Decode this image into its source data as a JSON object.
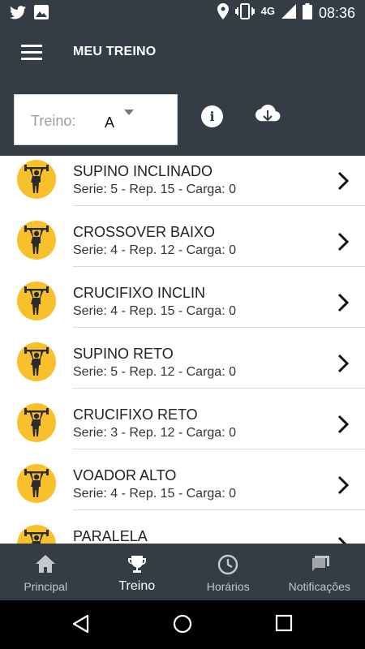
{
  "status_bar": {
    "time": "08:36",
    "network": "4G",
    "left_icons": [
      "twitter-icon",
      "image-icon"
    ],
    "right_icons": [
      "location-icon",
      "vibrate-icon",
      "signal-icon",
      "battery-icon"
    ]
  },
  "header": {
    "title": "MEU TREINO"
  },
  "treino_select": {
    "label": "Treino:",
    "value": "A"
  },
  "exercises": [
    {
      "name": "SUPINO INCLINADO",
      "detail": "Serie: 5 - Rep. 15 - Carga: 0"
    },
    {
      "name": "CROSSOVER BAIXO",
      "detail": "Serie: 4 - Rep. 12 - Carga: 0"
    },
    {
      "name": "CRUCIFIXO INCLIN",
      "detail": "Serie: 4 - Rep. 15 - Carga: 0"
    },
    {
      "name": "SUPINO RETO",
      "detail": "Serie: 5 - Rep. 12 - Carga: 0"
    },
    {
      "name": "CRUCIFIXO RETO",
      "detail": "Serie: 3 - Rep. 12 - Carga: 0"
    },
    {
      "name": "VOADOR ALTO",
      "detail": "Serie: 4 - Rep. 15 - Carga: 0"
    },
    {
      "name": "PARALELA",
      "detail": ""
    }
  ],
  "bottom_nav": [
    {
      "label": "Principal",
      "icon": "home-icon"
    },
    {
      "label": "Treino",
      "icon": "trophy-icon",
      "active": true
    },
    {
      "label": "Horários",
      "icon": "clock-icon"
    },
    {
      "label": "Notificações",
      "icon": "chat-icon"
    }
  ],
  "colors": {
    "primary": "#343c45",
    "accent": "#f8c02a"
  }
}
